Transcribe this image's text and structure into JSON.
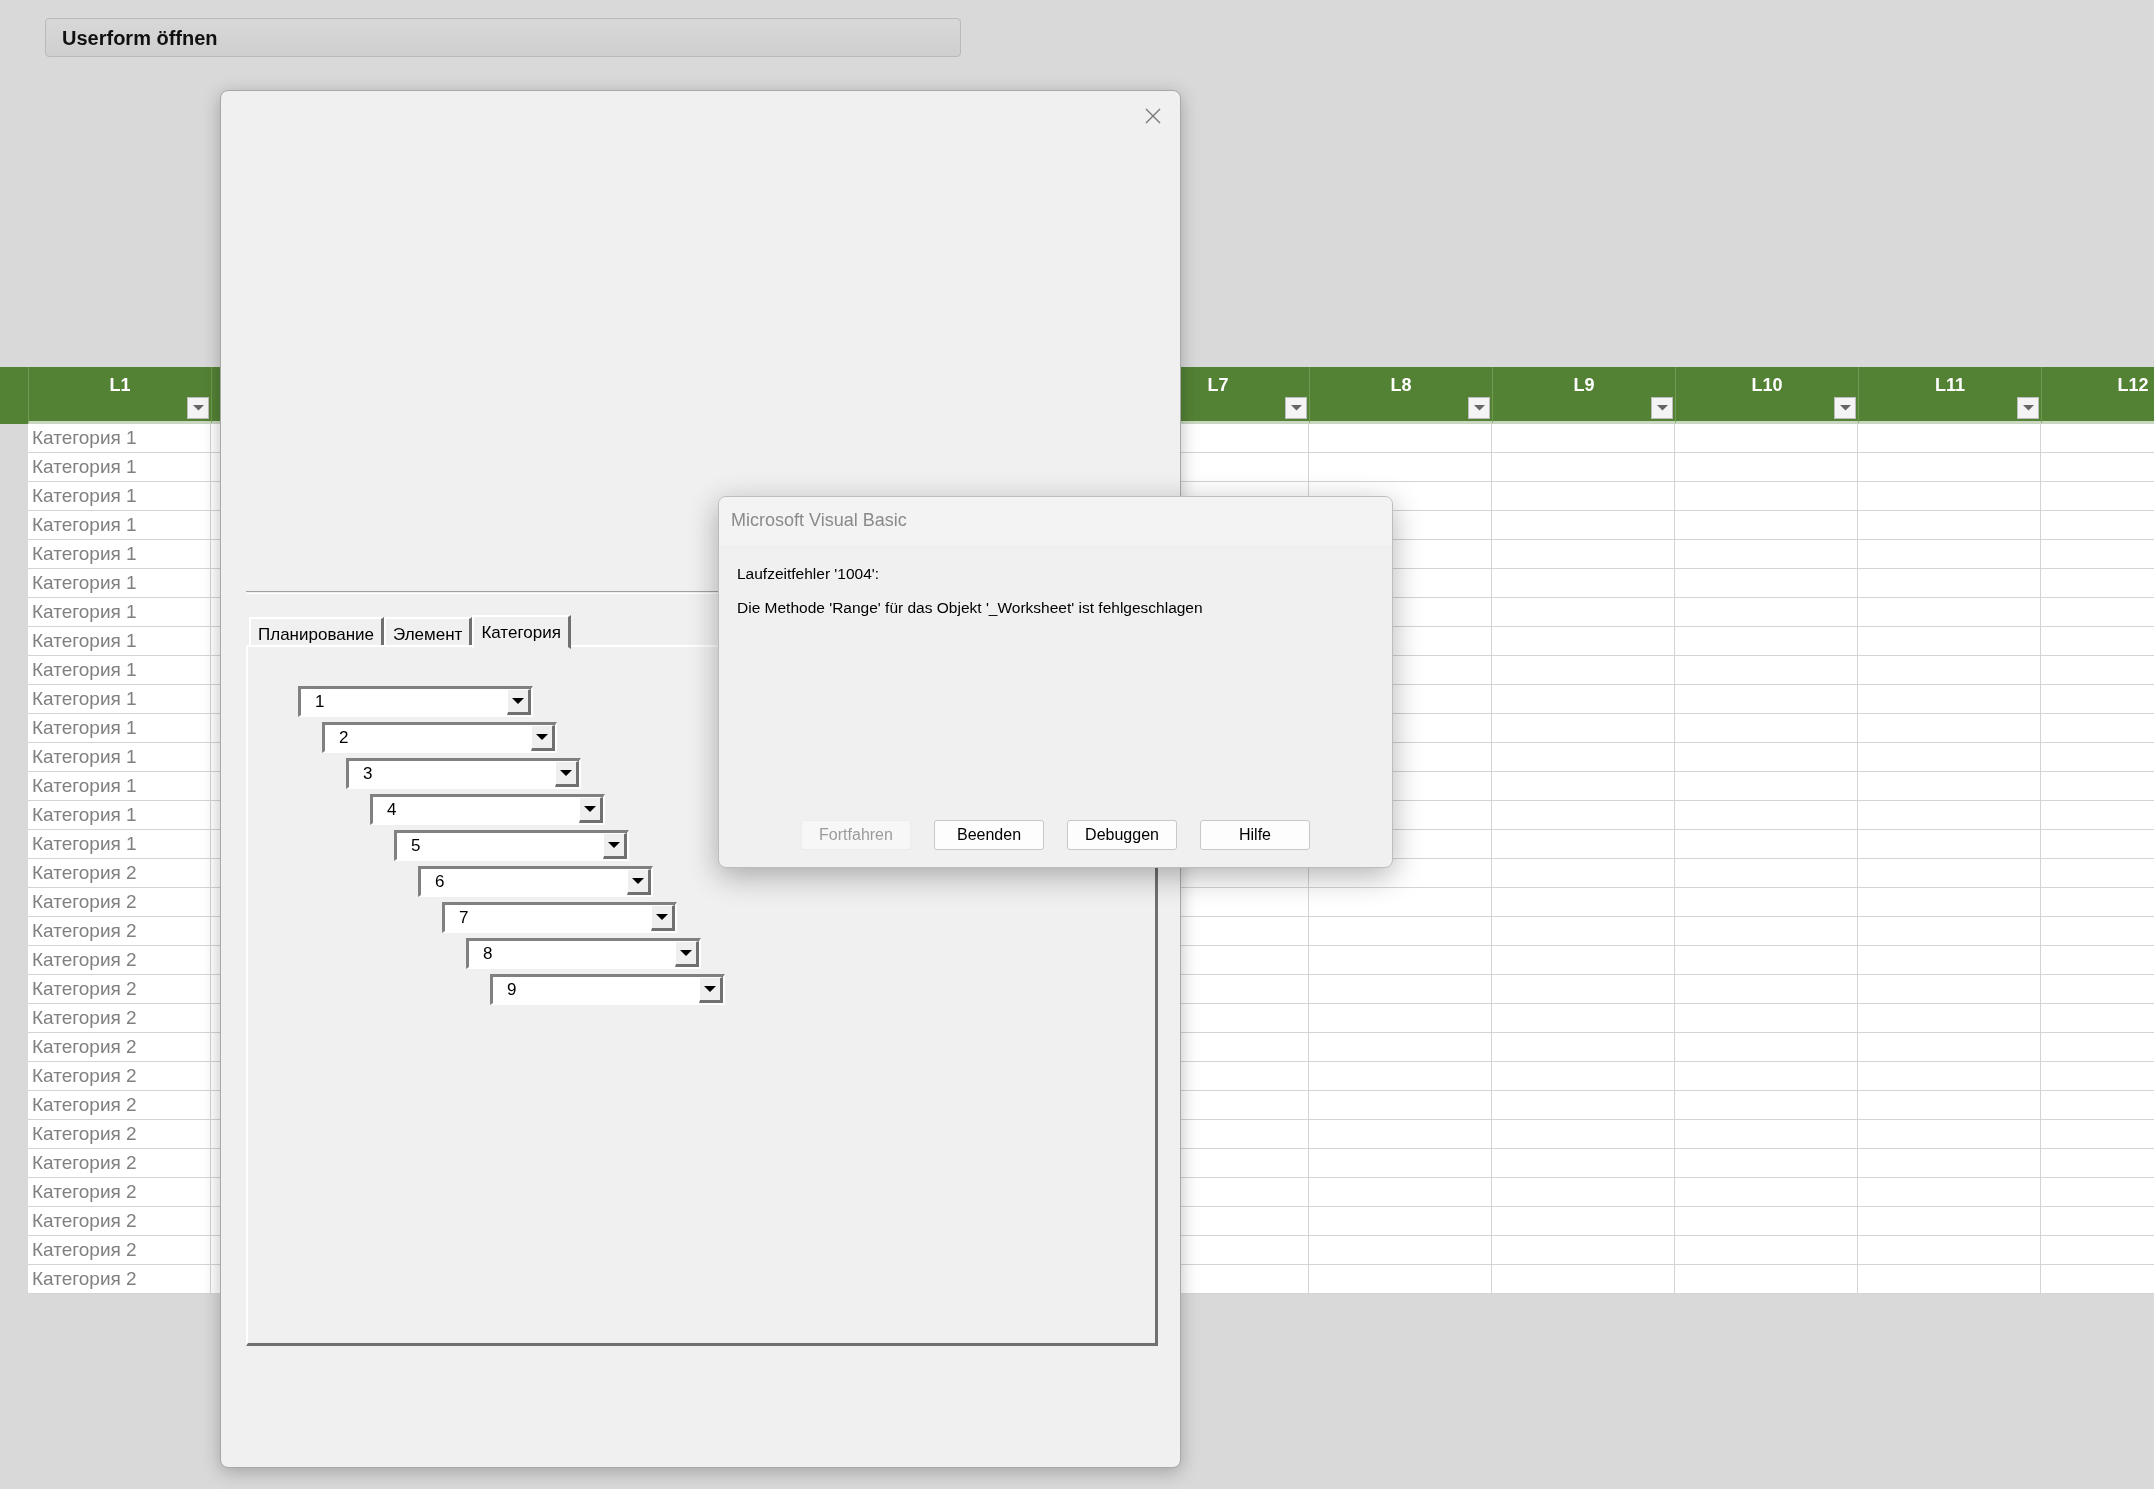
{
  "launch_button": {
    "label": "Userform öffnen"
  },
  "sheet": {
    "columns": [
      {
        "label": "L1",
        "filter": true
      },
      {
        "label": "L7",
        "filter": true
      },
      {
        "label": "L8",
        "filter": true
      },
      {
        "label": "L9",
        "filter": true
      },
      {
        "label": "L10",
        "filter": true
      },
      {
        "label": "L11",
        "filter": true
      },
      {
        "label": "L12",
        "filter": false
      }
    ],
    "rows": [
      "Категория 1",
      "Категория 1",
      "Категория 1",
      "Категория 1",
      "Категория 1",
      "Категория 1",
      "Категория 1",
      "Категория 1",
      "Категория 1",
      "Категория 1",
      "Категория 1",
      "Категория 1",
      "Категория 1",
      "Категория 1",
      "Категория 1",
      "Категория 2",
      "Категория 2",
      "Категория 2",
      "Категория 2",
      "Категория 2",
      "Категория 2",
      "Категория 2",
      "Категория 2",
      "Категория 2",
      "Категория 2",
      "Категория 2",
      "Категория 2",
      "Категория 2",
      "Категория 2",
      "Категория 2"
    ]
  },
  "userform": {
    "tabs": [
      {
        "label": "Планирование",
        "selected": false
      },
      {
        "label": "Элемент",
        "selected": false
      },
      {
        "label": "Категория",
        "selected": true
      }
    ],
    "combos": [
      {
        "value": "1"
      },
      {
        "value": "2"
      },
      {
        "value": "3"
      },
      {
        "value": "4"
      },
      {
        "value": "5"
      },
      {
        "value": "6"
      },
      {
        "value": "7"
      },
      {
        "value": "8"
      },
      {
        "value": "9"
      }
    ]
  },
  "error_dialog": {
    "title": "Microsoft Visual Basic",
    "lines": [
      "Laufzeitfehler '1004':",
      "Die Methode 'Range' für das Objekt '_Worksheet' ist fehlgeschlagen"
    ],
    "buttons": [
      {
        "label": "Fortfahren",
        "disabled": true
      },
      {
        "label": "Beenden",
        "disabled": false
      },
      {
        "label": "Debuggen",
        "disabled": false
      },
      {
        "label": "Hilfe",
        "disabled": false
      }
    ]
  }
}
